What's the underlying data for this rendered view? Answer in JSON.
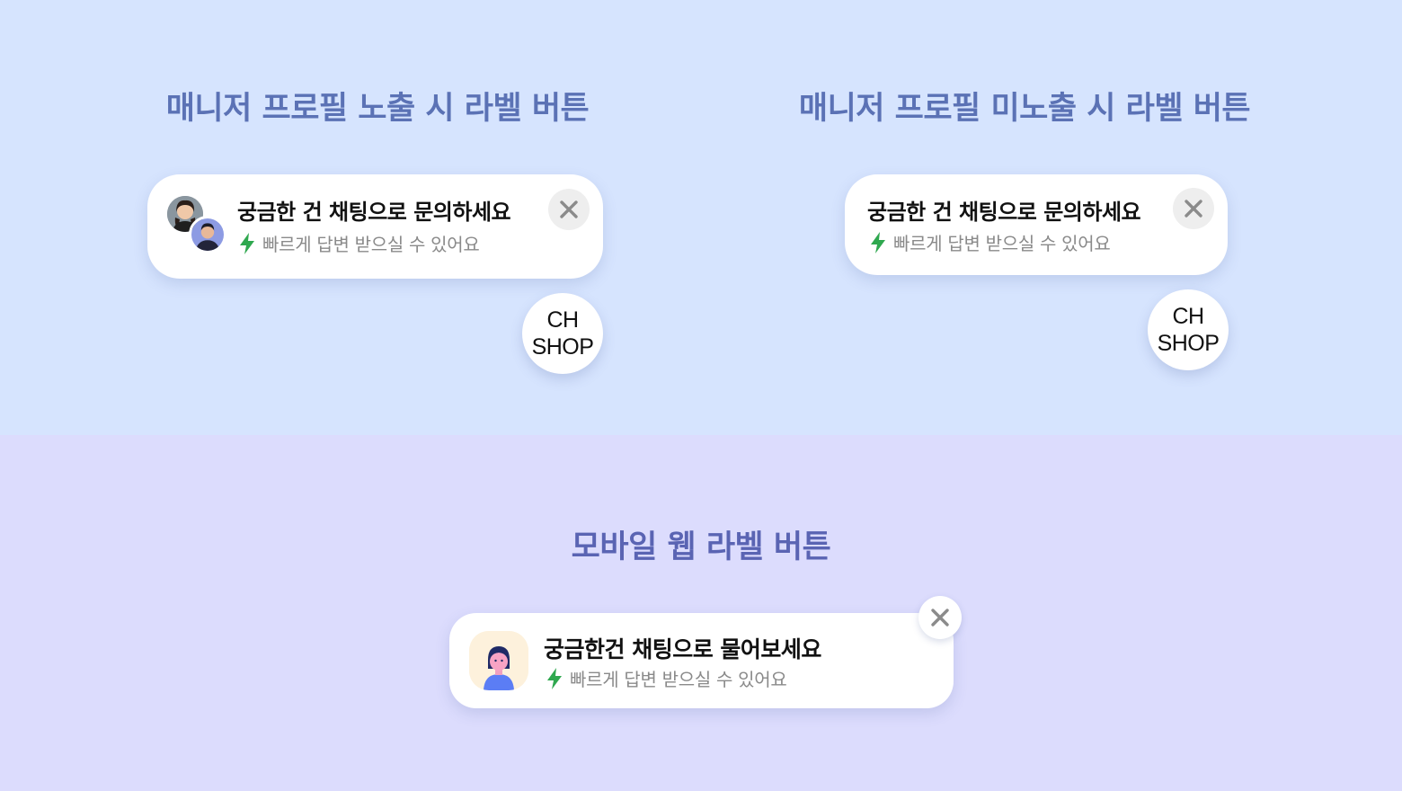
{
  "sections": {
    "profile_shown": {
      "heading": "매니저 프로필 노출 시 라벨 버튼",
      "card": {
        "title": "궁금한 건 채팅으로 문의하세요",
        "subtitle": "빠르게 답변 받으실 수 있어요",
        "close_icon": "close-icon",
        "bolt_icon": "lightning-bolt-icon"
      },
      "launcher": {
        "line1": "CH",
        "line2": "SHOP"
      }
    },
    "profile_hidden": {
      "heading": "매니저 프로필 미노출 시 라벨 버튼",
      "card": {
        "title": "궁금한 건 채팅으로 문의하세요",
        "subtitle": "빠르게 답변 받으실 수 있어요",
        "close_icon": "close-icon",
        "bolt_icon": "lightning-bolt-icon"
      },
      "launcher": {
        "line1": "CH",
        "line2": "SHOP"
      }
    },
    "mobile_web": {
      "heading": "모바일 웹 라벨 버튼",
      "card": {
        "title": "궁금한건 채팅으로 물어보세요",
        "subtitle": "빠르게 답변 받으실 수 있어요",
        "close_icon": "close-icon",
        "bolt_icon": "lightning-bolt-icon"
      }
    }
  },
  "colors": {
    "top_background": "#d6e4fe",
    "bottom_background": "#dcdcfd",
    "heading": "#5b72b5",
    "bolt": "#2fa84f",
    "subtitle": "#8a8a8a"
  }
}
